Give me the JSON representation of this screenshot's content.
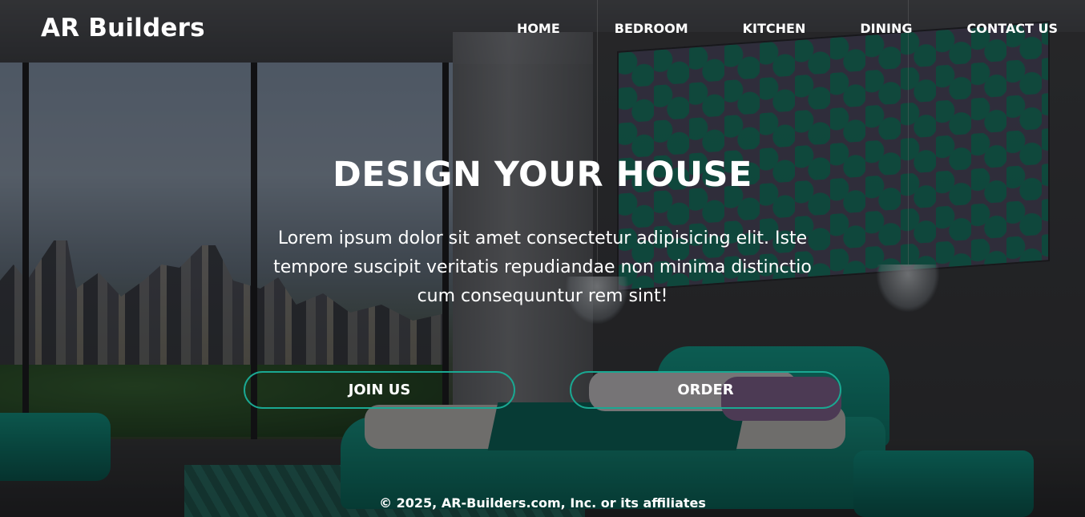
{
  "brand": {
    "name": "AR Builders"
  },
  "nav": {
    "items": [
      {
        "label": "HOME"
      },
      {
        "label": "BEDROOM"
      },
      {
        "label": "KITCHEN"
      },
      {
        "label": "DINING"
      },
      {
        "label": "CONTACT US"
      }
    ]
  },
  "hero": {
    "title": "DESIGN YOUR HOUSE",
    "text": "Lorem ipsum dolor sit amet consectetur adipisicing elit. Iste tempore suscipit veritatis repudiandae non minima distinctio cum consequuntur rem sint!",
    "buttons": {
      "join_label": "JOIN US",
      "order_label": "ORDER"
    },
    "background_image": "bedroom-interior-photo"
  },
  "footer": {
    "copyright": "© 2025, AR-Builders.com, Inc. or its affiliates"
  },
  "colors": {
    "button_border": "#1aa892",
    "text": "#ffffff",
    "overlay": "rgba(0,0,0,0.45)"
  }
}
